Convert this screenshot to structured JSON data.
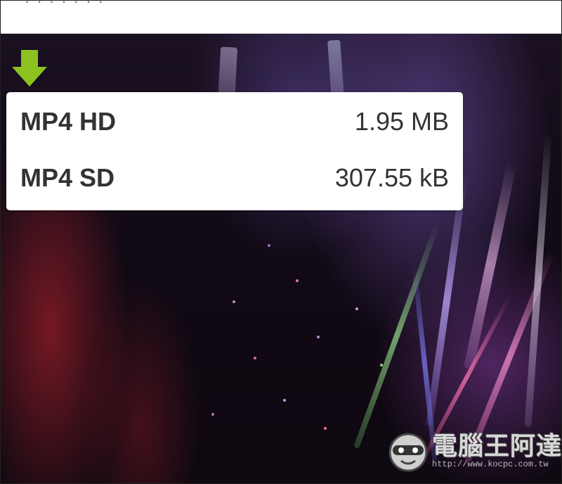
{
  "top_bar": {
    "cut_text": "· · · · · · ·"
  },
  "download_icon": {
    "icon": "download-arrow-icon",
    "color": "#8cc21f"
  },
  "format_menu": {
    "items": [
      {
        "label": "MP4 HD",
        "size": "1.95 MB"
      },
      {
        "label": "MP4 SD",
        "size": "307.55 kB"
      }
    ]
  },
  "watermark": {
    "title": "電腦王阿達",
    "url": "http://www.kocpc.com.tw"
  }
}
